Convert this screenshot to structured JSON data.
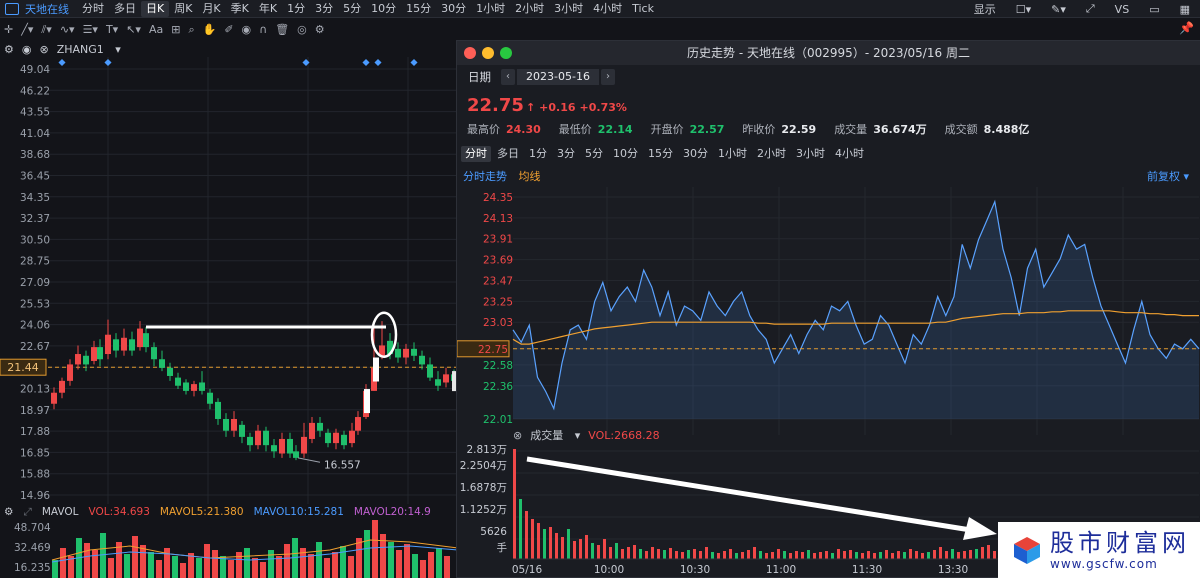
{
  "topbar": {
    "stock_name": "天地在线",
    "periods": [
      "分时",
      "多日",
      "日K",
      "周K",
      "月K",
      "季K",
      "年K",
      "1分",
      "3分",
      "5分",
      "10分",
      "15分",
      "30分",
      "1小时",
      "2小时",
      "3小时",
      "4小时",
      "Tick"
    ],
    "active_period": "日K",
    "display_label": "显示",
    "vs_label": "VS"
  },
  "toolbar": {
    "font_label": "Aa"
  },
  "main": {
    "indicator_name": "ZHANG1",
    "y_ticks": [
      "49.04",
      "46.22",
      "43.55",
      "41.04",
      "38.68",
      "36.45",
      "34.35",
      "32.37",
      "30.50",
      "28.75",
      "27.09",
      "25.53",
      "24.06",
      "22.67",
      "21.44",
      "20.13",
      "18.97",
      "17.88",
      "16.85",
      "15.88",
      "14.96"
    ],
    "current_price_tag": "21.44",
    "low_annotation": "16.557",
    "vol_header": {
      "name": "MAVOL",
      "vol": "VOL:34.693",
      "ma5": "MAVOL5:21.380",
      "ma10": "MAVOL10:15.281",
      "ma20": "MAVOL20:14.9"
    },
    "vol_ticks": [
      "48.704",
      "32.469",
      "16.235"
    ],
    "colors": {
      "up": "#f04848",
      "down": "#1fc06c",
      "ma5": "#f0a030",
      "ma10": "#4b9bff",
      "ma20": "#c060d0"
    }
  },
  "popup": {
    "title": "历史走势 - 天地在线（002995）- 2023/05/16 周二",
    "date_label": "日期",
    "date_value": "2023-05-16",
    "price": "22.75",
    "change": "+0.16",
    "change_pct": "+0.73%",
    "stats": [
      {
        "k": "最高价",
        "v": "24.30",
        "color": "#f04848"
      },
      {
        "k": "最低价",
        "v": "22.14",
        "color": "#1fc06c"
      },
      {
        "k": "开盘价",
        "v": "22.57",
        "color": "#1fc06c"
      },
      {
        "k": "昨收价",
        "v": "22.59",
        "color": "#e8eaee"
      },
      {
        "k": "成交量",
        "v": "36.674万",
        "color": "#e8eaee"
      },
      {
        "k": "成交额",
        "v": "8.488亿",
        "color": "#e8eaee"
      }
    ],
    "tabs": [
      "分时",
      "多日",
      "1分",
      "3分",
      "5分",
      "10分",
      "15分",
      "30分",
      "1小时",
      "2小时",
      "3小时",
      "4小时"
    ],
    "active_tab": "分时",
    "legend_intraday": "分时走势",
    "legend_avg": "均线",
    "adjust_label": "前复权",
    "vol_name": "成交量",
    "vol_value": "VOL:2668.28",
    "vol_ticks": [
      "2.813万",
      "2.2504万",
      "1.6878万",
      "1.1252万",
      "5626",
      "手"
    ],
    "time_labels": [
      "05/16",
      "10:00",
      "10:30",
      "11:00",
      "11:30",
      "13:30"
    ]
  },
  "chart_data": {
    "type": "line",
    "title": "",
    "xlabel": "",
    "ylabel": "",
    "y_ticks": [
      24.35,
      24.13,
      23.91,
      23.69,
      23.47,
      23.25,
      23.03,
      22.75,
      22.58,
      22.36,
      22.01
    ],
    "ylim": [
      22.01,
      24.35
    ],
    "prev_close": 22.59,
    "current": 22.75,
    "series": [
      {
        "values": [
          22.95,
          22.82,
          23.0,
          22.45,
          22.3,
          22.12,
          22.6,
          22.95,
          23.0,
          22.85,
          23.25,
          23.45,
          23.15,
          23.3,
          23.4,
          23.25,
          23.58,
          23.4,
          23.1,
          23.35,
          23.0,
          23.2,
          23.15,
          23.05,
          23.35,
          23.2,
          23.1,
          23.25,
          23.35,
          23.1,
          22.95,
          22.85,
          22.6,
          22.75,
          22.9,
          22.7,
          22.9,
          23.05,
          22.95,
          23.2,
          23.15,
          23.25,
          23.0,
          22.8,
          22.85,
          23.1,
          23.0,
          22.8,
          22.6,
          22.9,
          22.8,
          23.0,
          23.3,
          23.1,
          23.3,
          23.85,
          23.6,
          23.9,
          24.1,
          24.3,
          23.8,
          23.5,
          23.1,
          23.6,
          23.8,
          23.4,
          23.55,
          23.7,
          23.95,
          23.8,
          23.85,
          23.5,
          23.2,
          23.0,
          22.8,
          22.6,
          22.95,
          23.25,
          22.9,
          22.75,
          22.65,
          22.8,
          22.75,
          22.85,
          22.75
        ]
      },
      {
        "values": [
          22.85,
          22.8,
          22.8,
          22.82,
          22.84,
          22.86,
          22.88,
          22.9,
          22.92,
          22.94,
          22.96,
          22.97,
          22.98,
          22.99,
          23.0,
          23.01,
          23.02,
          23.03,
          23.03,
          23.03,
          23.03,
          23.03,
          23.03,
          23.03,
          23.03,
          23.03,
          23.03,
          23.03,
          23.03,
          23.03,
          23.02,
          23.02,
          23.01,
          23.01,
          23.01,
          23.01,
          23.01,
          23.01,
          23.01,
          23.02,
          23.02,
          23.02,
          23.02,
          23.02,
          23.02,
          23.02,
          23.02,
          23.02,
          23.02,
          23.02,
          23.02,
          23.02,
          23.03,
          23.03,
          23.05,
          23.07,
          23.08,
          23.09,
          23.1,
          23.11,
          23.12,
          23.12,
          23.12,
          23.13,
          23.13,
          23.13,
          23.14,
          23.14,
          23.15,
          23.15,
          23.15,
          23.15,
          23.15,
          23.15,
          23.14,
          23.13,
          23.13,
          23.13,
          23.12,
          23.12,
          23.11,
          23.11,
          23.1,
          23.1,
          23.1
        ]
      }
    ]
  }
}
